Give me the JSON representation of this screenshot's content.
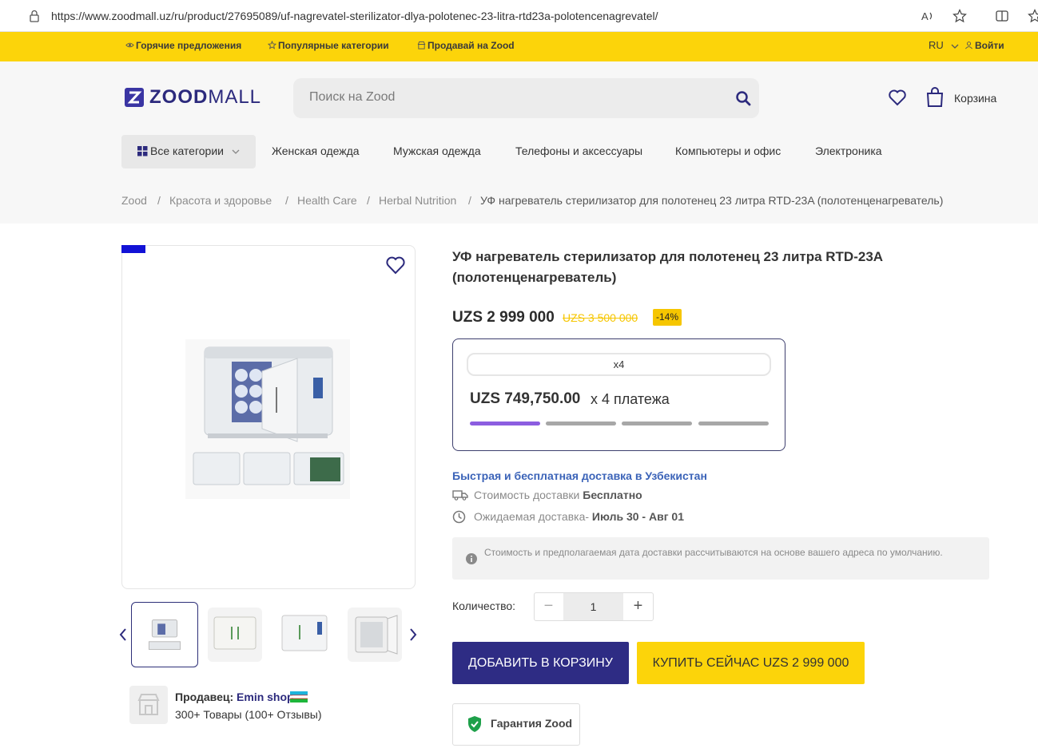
{
  "browser": {
    "url": "https://www.zoodmall.uz/ru/product/27695089/uf-nagrevatel-sterilizator-dlya-polotenec-23-litra-rtd23a-polotencenagrevatel/"
  },
  "top_strip": {
    "hot_deals": "Горячие предложения",
    "popular_categories": "Популярные категории",
    "sell_on_zood": "Продавай на Zood",
    "language": "RU",
    "login": "Войти"
  },
  "header": {
    "logo_strong": "ZOOD",
    "logo_light": "MALL",
    "search_placeholder": "Поиск на Zood",
    "cart_label": "Корзина"
  },
  "nav": {
    "all_categories": "Все категории",
    "items": [
      "Женская одежда",
      "Мужская одежда",
      "Телефоны и аксессуары",
      "Компьютеры и офис",
      "Электроника"
    ]
  },
  "breadcrumb": {
    "items": [
      "Zood",
      "Красота и здоровье",
      "Health Care",
      "Herbal Nutrition"
    ],
    "current": "УФ нагреватель стерилизатор для полотенец 23 литра RTD-23A (полотенценагреватель)",
    "separator": "/"
  },
  "product": {
    "title": "УФ нагреватель стерилизатор для полотенец 23 литра RTD-23A (полотенценагреватель)",
    "price": "UZS 2 999 000",
    "old_price": "UZS 3 500 000",
    "discount": "-14%",
    "installment_tab": "x4",
    "installment_amount": "UZS 749,750.00",
    "installment_times": "x 4 платежа",
    "installment_progress": 0.25
  },
  "delivery": {
    "headline": "Быстрая и бесплатная доставка в Узбекистан",
    "cost_label": "Стоимость доставки ",
    "cost_value": "Бесплатно",
    "eta_label": "Ожидаемая доставка- ",
    "eta_value": "Июль 30 - Авг 01",
    "info": "Стоимость и предполагаемая дата доставки рассчитываются на основе вашего адреса по умолчанию."
  },
  "quantity": {
    "label": "Количество:",
    "value": "1",
    "minus": "−",
    "plus": "+"
  },
  "actions": {
    "add_to_cart": "ДОБАВИТЬ В КОРЗИНУ",
    "buy_now": "КУПИТЬ СЕЙЧАС UZS 2 999 000"
  },
  "guarantee": "Гарантия Zood",
  "seller": {
    "label": "Продавец: ",
    "name": "Emin shop",
    "stats": "300+ Товары (100+ Отзывы)"
  },
  "colors": {
    "brand_yellow": "#fcd40a",
    "brand_navy": "#2e2c84",
    "installment_accent": "#8c5de0",
    "delivery_link": "#3b63b8"
  }
}
